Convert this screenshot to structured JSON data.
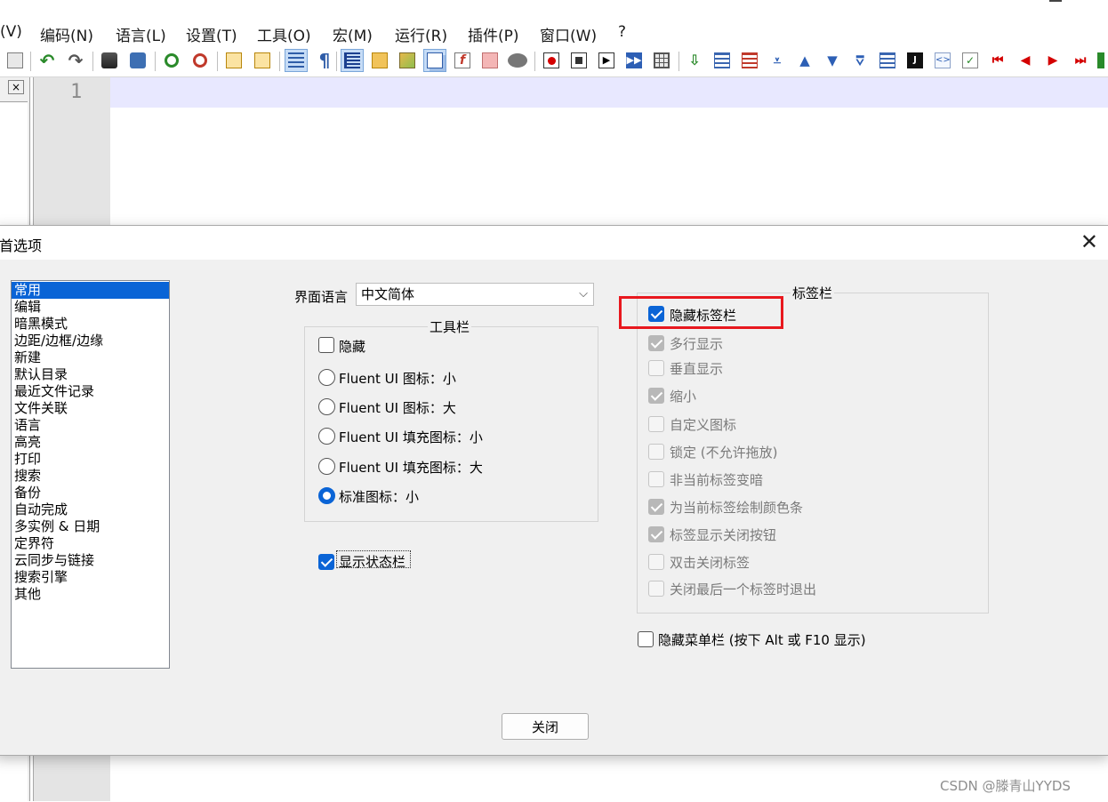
{
  "menubar": {
    "items": [
      "(V)",
      "编码(N)",
      "语言(L)",
      "设置(T)",
      "工具(O)",
      "宏(M)",
      "运行(R)",
      "插件(P)",
      "窗口(W)",
      "?"
    ]
  },
  "toolbar": {
    "icons": [
      "paste-icon",
      "undo-icon",
      "redo-icon",
      "find-icon",
      "replace-icon",
      "zoom-in-icon",
      "zoom-out-icon",
      "sync-vertical-icon",
      "sync-horizontal-icon",
      "word-wrap-icon",
      "show-all-chars-icon",
      "indent-guide-icon",
      "folder-as-workspace-icon",
      "document-map-icon",
      "document-list-icon",
      "function-list-icon",
      "project-panel-icon",
      "monitoring-icon",
      "record-macro-icon",
      "stop-record-icon",
      "play-macro-icon",
      "run-macro-multiple-icon",
      "save-macro-icon"
    ]
  },
  "editor": {
    "line_number": "1",
    "left_panel_close": "×"
  },
  "dialog": {
    "title": "首选项",
    "close_glyph": "✕",
    "categories": [
      "常用",
      "编辑",
      "暗黑模式",
      "边距/边框/边缘",
      "新建",
      "默认目录",
      "最近文件记录",
      "文件关联",
      "语言",
      "高亮",
      "打印",
      "搜索",
      "备份",
      "自动完成",
      "多实例 & 日期",
      "定界符",
      "云同步与链接",
      "搜索引擎",
      "其他"
    ],
    "selected_category": "常用",
    "ui_language_label": "界面语言",
    "ui_language_value": "中文简体",
    "toolbar_group": {
      "title": "工具栏",
      "hide_label": "隐藏",
      "hide_checked": false,
      "radio_options": [
        "Fluent UI 图标：小",
        "Fluent UI 图标：大",
        "Fluent UI 填充图标：小",
        "Fluent UI 填充图标：大",
        "标准图标：小"
      ],
      "selected_radio": "标准图标：小"
    },
    "show_statusbar_label": "显示状态栏",
    "show_statusbar_checked": true,
    "tabbar_group": {
      "title": "标签栏",
      "hide_tabbar_label": "隐藏标签栏",
      "hide_tabbar_checked": true,
      "options": [
        {
          "label": "多行显示",
          "checked": true
        },
        {
          "label": "垂直显示",
          "checked": false
        },
        {
          "label": "缩小",
          "checked": true
        },
        {
          "label": "自定义图标",
          "checked": false
        },
        {
          "label": "锁定 (不允许拖放)",
          "checked": false
        },
        {
          "label": "非当前标签变暗",
          "checked": false
        },
        {
          "label": "为当前标签绘制颜色条",
          "checked": true
        },
        {
          "label": "标签显示关闭按钮",
          "checked": true
        },
        {
          "label": "双击关闭标签",
          "checked": false
        },
        {
          "label": "关闭最后一个标签时退出",
          "checked": false
        }
      ]
    },
    "hide_menubar_label": "隐藏菜单栏 (按下 Alt 或 F10 显示)",
    "hide_menubar_checked": false,
    "close_button_label": "关闭"
  },
  "watermark": "CSDN @滕青山YYDS",
  "colors": {
    "accent": "#0a64d6",
    "highlight_box": "#e8181e",
    "current_line": "#e8e8ff"
  }
}
